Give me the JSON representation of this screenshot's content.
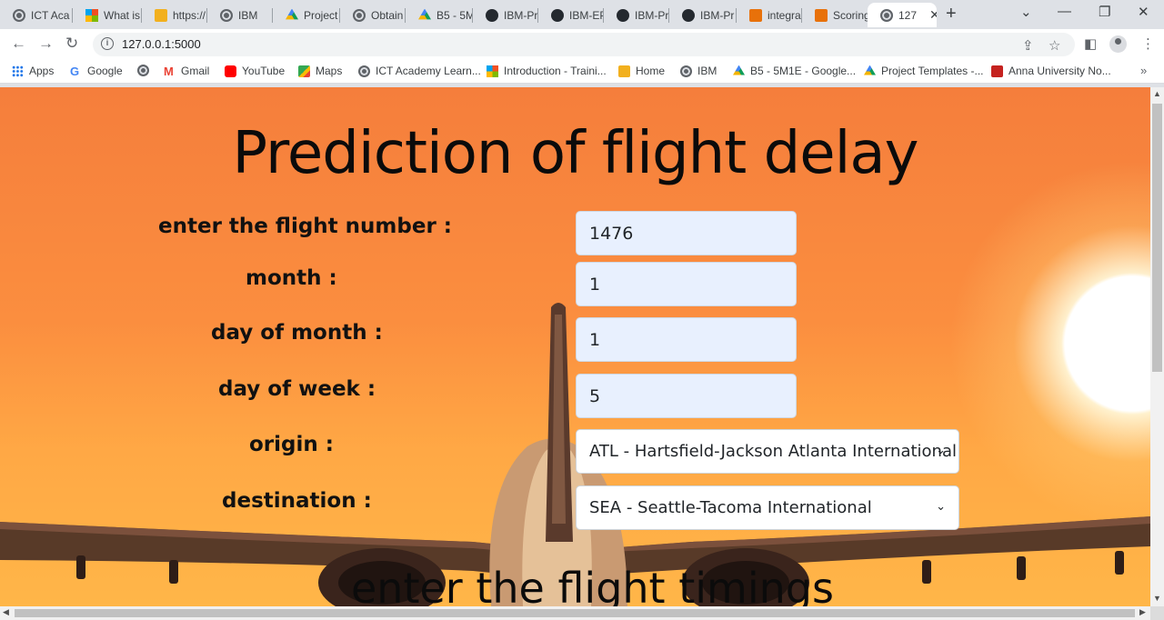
{
  "browser": {
    "tabs": [
      {
        "label": "ICT Aca",
        "icon": "globe"
      },
      {
        "label": "What is",
        "icon": "ms"
      },
      {
        "label": "https://",
        "icon": "box"
      },
      {
        "label": "IBM",
        "icon": "globe"
      },
      {
        "label": "Project",
        "icon": "drive"
      },
      {
        "label": "Obtain",
        "icon": "globe"
      },
      {
        "label": "B5 - 5M",
        "icon": "drive"
      },
      {
        "label": "IBM-Pr",
        "icon": "github"
      },
      {
        "label": "IBM-EP",
        "icon": "github"
      },
      {
        "label": "IBM-Pr",
        "icon": "github"
      },
      {
        "label": "IBM-Pr",
        "icon": "github"
      },
      {
        "label": "integra",
        "icon": "book"
      },
      {
        "label": "Scoring",
        "icon": "book"
      },
      {
        "label": "127",
        "icon": "globe",
        "active": true
      }
    ],
    "new_tab": "+",
    "window_controls": {
      "tab_search": "⌄",
      "minimize": "—",
      "restore": "❐",
      "close": "✕"
    },
    "address": {
      "url": "127.0.0.1:5000"
    },
    "bookmarks": [
      {
        "label": "Apps",
        "icon": "apps"
      },
      {
        "label": "Google",
        "icon": "google"
      },
      {
        "label": "",
        "icon": "globe"
      },
      {
        "label": "Gmail",
        "icon": "gmail"
      },
      {
        "label": "YouTube",
        "icon": "youtube"
      },
      {
        "label": "Maps",
        "icon": "maps"
      },
      {
        "label": "ICT Academy Learn...",
        "icon": "globe"
      },
      {
        "label": "Introduction - Traini...",
        "icon": "ms"
      },
      {
        "label": "Home",
        "icon": "box"
      },
      {
        "label": "IBM",
        "icon": "globe"
      },
      {
        "label": "B5 - 5M1E - Google...",
        "icon": "drive"
      },
      {
        "label": "Project Templates -...",
        "icon": "drive"
      },
      {
        "label": "Anna University No...",
        "icon": "anna"
      }
    ],
    "bookmarks_more": "»"
  },
  "page": {
    "title": "Prediction of flight delay",
    "form": {
      "flight_number": {
        "label": "enter the flight number :",
        "value": "1476"
      },
      "month": {
        "label": "month :",
        "value": "1"
      },
      "day_of_month": {
        "label": "day of month :",
        "value": "1"
      },
      "day_of_week": {
        "label": "day of week :",
        "value": "5"
      },
      "origin": {
        "label": "origin :",
        "value": "ATL - Hartsfield-Jackson Atlanta International"
      },
      "destination": {
        "label": "destination :",
        "value": "SEA - Seattle-Tacoma International"
      }
    },
    "timings_heading": "enter the flight timings"
  }
}
